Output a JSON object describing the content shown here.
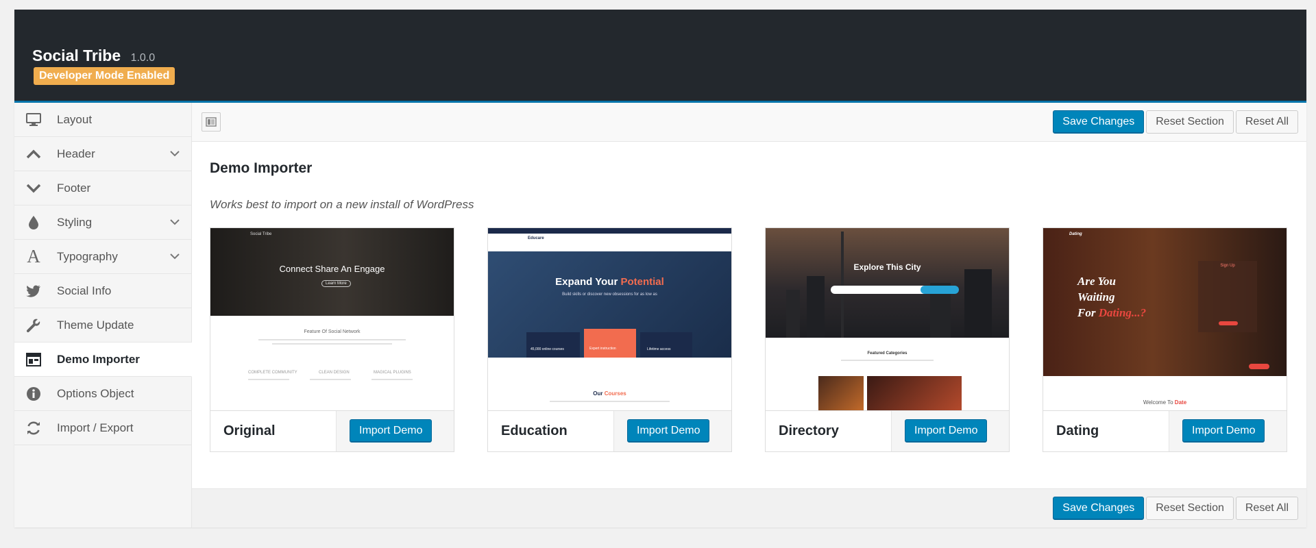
{
  "header": {
    "title": "Social Tribe",
    "version": "1.0.0",
    "badge": "Developer Mode Enabled",
    "accent": "#0073aa",
    "background": "#23282d"
  },
  "sidebar": {
    "items": [
      {
        "label": "Layout",
        "icon": "desktop-icon",
        "chevron": false
      },
      {
        "label": "Header",
        "icon": "chevron-up-icon",
        "chevron": true
      },
      {
        "label": "Footer",
        "icon": "chevron-down-icon",
        "chevron": false
      },
      {
        "label": "Styling",
        "icon": "droplet-icon",
        "chevron": true
      },
      {
        "label": "Typography",
        "icon": "typography-icon",
        "chevron": true
      },
      {
        "label": "Social Info",
        "icon": "twitter-icon",
        "chevron": false
      },
      {
        "label": "Theme Update",
        "icon": "wrench-icon",
        "chevron": false
      },
      {
        "label": "Demo Importer",
        "icon": "layout-icon",
        "chevron": false,
        "active": true
      },
      {
        "label": "Options Object",
        "icon": "info-icon",
        "chevron": false
      },
      {
        "label": "Import / Export",
        "icon": "refresh-icon",
        "chevron": false
      }
    ]
  },
  "toolbar": {
    "save_label": "Save Changes",
    "reset_section_label": "Reset Section",
    "reset_all_label": "Reset All"
  },
  "section": {
    "title": "Demo Importer",
    "description": "Works best to import on a new install of WordPress"
  },
  "demos": [
    {
      "name": "Original",
      "button": "Import Demo",
      "thumb": {
        "logo": "Social Tribe",
        "headline": "Connect Share An Engage",
        "cta": "Learn More",
        "section": "Feature Of Social Network",
        "features": [
          "COMPLETE COMMUNITY",
          "CLEAN DESIGN",
          "MAGICAL PLUGINS"
        ]
      }
    },
    {
      "name": "Education",
      "button": "Import Demo",
      "thumb": {
        "logo": "Educare",
        "headline_a": "Expand Your ",
        "headline_b": "Potential",
        "sub": "Build skills or discover new obsessions for as low as",
        "stats": [
          "45,000 online courses",
          "Expert instruction",
          "Lifetime access"
        ],
        "section_a": "Our ",
        "section_b": "Courses"
      }
    },
    {
      "name": "Directory",
      "button": "Import Demo",
      "thumb": {
        "headline": "Explore This City",
        "section": "Featured Categories"
      }
    },
    {
      "name": "Dating",
      "button": "Import Demo",
      "thumb": {
        "logo": "Dating",
        "line1": "Are You",
        "line2": "Waiting",
        "line3a": "For ",
        "line3b": "Dating...?",
        "form": "Sign Up",
        "section_a": "Welcome To ",
        "section_b": "Date"
      }
    }
  ]
}
